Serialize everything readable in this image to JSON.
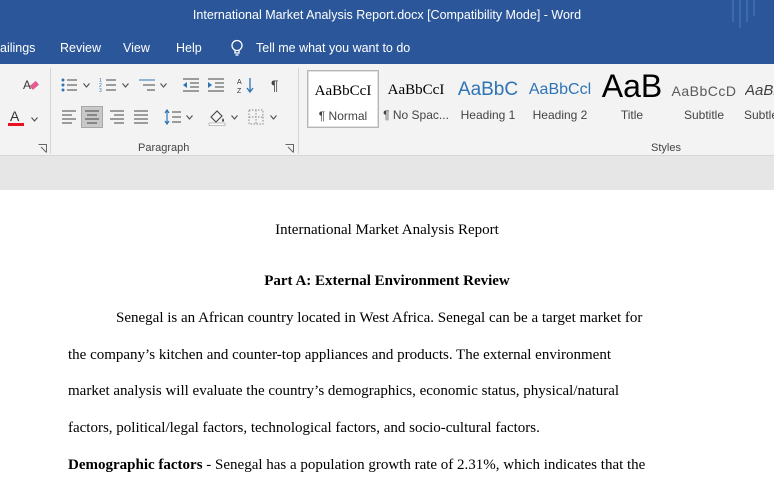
{
  "window": {
    "title": "International Market Analysis Report.docx [Compatibility Mode]  -  Word"
  },
  "tabs": {
    "mailings": "ailings",
    "review": "Review",
    "view": "View",
    "help": "Help",
    "tell_me": "Tell me what you want to do"
  },
  "ribbon": {
    "paragraph_label": "Paragraph",
    "styles_label": "Styles",
    "styles": [
      {
        "preview": "AaBbCcI",
        "name": "¶ Normal"
      },
      {
        "preview": "AaBbCcI",
        "name": "¶ No Spac..."
      },
      {
        "preview": "AaBbC",
        "name": "Heading 1"
      },
      {
        "preview": "AaBbCcl",
        "name": "Heading 2"
      },
      {
        "preview": "AaB",
        "name": "Title"
      },
      {
        "preview": "AaBbCcD",
        "name": "Subtitle"
      },
      {
        "preview": "AaBl",
        "name": "Subtle"
      }
    ],
    "colors": {
      "font_color": "#e81123",
      "heading_blue": "#2e74b5",
      "accent": "#2b579a"
    }
  },
  "document": {
    "title": "International Market Analysis Report",
    "heading": "Part A: External Environment Review",
    "para1": [
      "Senegal is an African country located in West Africa. Senegal can be a target market for",
      "the company’s kitchen and counter-top appliances and products. The external environment",
      "market analysis will evaluate the country’s demographics, economic status, physical/natural",
      "factors, political/legal factors, technological factors, and socio-cultural factors."
    ],
    "para2_bold": "Demographic factors",
    "para2_rest": " - Senegal has a population growth rate of 2.31%, which indicates that the"
  }
}
